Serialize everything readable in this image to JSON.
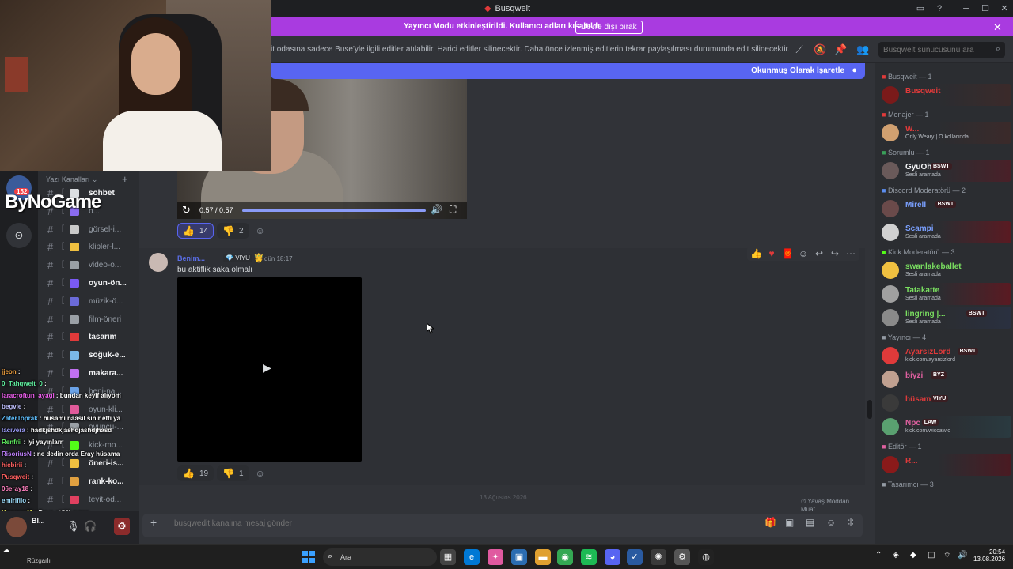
{
  "window": {
    "title": "Busqweit",
    "title_icon": "busqweit-logo-icon"
  },
  "banner": {
    "text": "Yayıncı Modu etkinleştirildi. Kullanıcı adları kısaltıldı.",
    "button": "Devre dışı bırak",
    "color": "#a93be0"
  },
  "channel_header": {
    "topic": "it odasına sadece Buse'yle ilgili editler atılabilir. Harici editler silinecektir. Daha önce izlenmiş editlerin tekrar paylaşılması durumunda edit silinecektir. Editör rolü...",
    "search_placeholder": "Busqweit sunucusunu ara"
  },
  "mark_read": {
    "label": "Okunmuş Olarak İşaretle",
    "color": "#5865f2"
  },
  "sidebar": {
    "category": "Yazı Kanalları",
    "badge": "152",
    "brand_overlay": "ByNoGame",
    "channels": [
      {
        "name": "sohbet",
        "unread": true,
        "color": "#dbdee1"
      },
      {
        "name": "b...",
        "unread": false,
        "color": "#8a6cf0"
      },
      {
        "name": "görsel-i...",
        "unread": false,
        "color": "#c9c9c9"
      },
      {
        "name": "klipler-l...",
        "unread": false,
        "color": "#f0c040"
      },
      {
        "name": "video-ö...",
        "unread": false,
        "color": "#9aa0a6"
      },
      {
        "name": "oyun-ön...",
        "unread": true,
        "color": "#7a5af5"
      },
      {
        "name": "müzik-ö...",
        "unread": false,
        "color": "#6b6bd9"
      },
      {
        "name": "film-öneri",
        "unread": false,
        "color": "#9aa0a6"
      },
      {
        "name": "tasarım",
        "unread": true,
        "color": "#e03a3a"
      },
      {
        "name": "soğuk-e...",
        "unread": true,
        "color": "#7ab8e8"
      },
      {
        "name": "makara...",
        "unread": true,
        "color": "#c070f0"
      },
      {
        "name": "beni-na...",
        "unread": false,
        "color": "#6ba3e8"
      },
      {
        "name": "oyun-kli...",
        "unread": false,
        "color": "#e05a9a"
      },
      {
        "name": "oyuncu-...",
        "unread": false,
        "color": "#9aa0a6"
      },
      {
        "name": "kick-mo...",
        "unread": false,
        "color": "#53fc18"
      },
      {
        "name": "öneri-is...",
        "unread": true,
        "color": "#f0c040"
      },
      {
        "name": "rank-ko...",
        "unread": true,
        "color": "#e0a040"
      },
      {
        "name": "teyit-od...",
        "unread": false,
        "color": "#e04060"
      }
    ]
  },
  "chat_overlay": [
    {
      "user": "jjeon",
      "msg": ":",
      "color": "#f0a040"
    },
    {
      "user": "0_Tahqweit_0",
      "msg": ":",
      "color": "#60f0a0"
    },
    {
      "user": "laracroftun_ayagi",
      "msg": ": bundan keyif alıyom",
      "color": "#f060f0"
    },
    {
      "user": "begvie",
      "msg": ":",
      "color": "#c0c0ff"
    },
    {
      "user": "ZaferToprak",
      "msg": ": hüsamı naasıl sinir etti ya",
      "color": "#60c0ff"
    },
    {
      "user": "lacivera",
      "msg": ": hadkjshdkjashdjashdjhasd",
      "color": "#a0a0ff"
    },
    {
      "user": "Renfrii",
      "msg": ": iyi yayınlarr",
      "color": "#60f060"
    },
    {
      "user": "RisoriusN",
      "msg": ": ne dedin orda Eray hüsama",
      "color": "#c080ff"
    },
    {
      "user": "hicbirii",
      "msg": ":",
      "color": "#ff6060"
    },
    {
      "user": "Pusqweit",
      "msg": ":",
      "color": "#ff6060"
    },
    {
      "user": "06eray18",
      "msg": ":",
      "color": "#ff80c0"
    },
    {
      "user": "emirifilo",
      "msg": ":",
      "color": "#a0e0ff"
    },
    {
      "user": "Kruuser46",
      "msg": ": Dava ettiği evren",
      "color": "#f0f060"
    },
    {
      "user": "Whiqqweit",
      "msg": ":",
      "color": "#c0c0c0"
    },
    {
      "user": "ZaferToprak",
      "msg": ":",
      "color": "#60c0ff"
    },
    {
      "user": "lasiyom",
      "msg": ": ASJDHKJASDHA",
      "color": "#a0ffa0"
    }
  ],
  "user_panel": {
    "name": "Bl..."
  },
  "message1": {
    "video_time": "0:57 / 0:57",
    "reactions": [
      {
        "emoji": "👍",
        "count": "14",
        "active": true
      },
      {
        "emoji": "👎",
        "count": "2",
        "active": false
      }
    ]
  },
  "message2": {
    "author": "Benim...",
    "tag": "VIYU",
    "timestamp": "dün 18:17",
    "text": "bu aktiflik saka olmalı",
    "reactions": [
      {
        "emoji": "👍",
        "count": "19",
        "active": false
      },
      {
        "emoji": "👎",
        "count": "1",
        "active": false
      }
    ]
  },
  "divider": {
    "date": "13 Ağustos 2026",
    "slowmode": "Yavaş Moddan Muaf"
  },
  "composer": {
    "placeholder": "busqwedit kanalına mesaj gönder"
  },
  "members": {
    "roles": [
      {
        "header": "Busqweit — 1",
        "color": "#e03a3a",
        "members": [
          {
            "name": "Busqweit",
            "color": "#e03a3a",
            "sub": "",
            "badge": "",
            "ava": "#7a1a1a",
            "bg": "#3b2a2a"
          }
        ]
      },
      {
        "header": "Menajer — 1",
        "color": "#e03a3a",
        "members": [
          {
            "name": "W...",
            "color": "#e03a3a",
            "sub": "Only Weary | O kollarında...",
            "badge": "",
            "ava": "#d0a070",
            "bg": "#3b2a2a"
          }
        ]
      },
      {
        "header": "Sorumlu — 1",
        "color": "#3aa05a",
        "members": [
          {
            "name": "GyuOh",
            "color": "#f2f3f5",
            "sub": "Sesli aramada",
            "badge": "BSWT",
            "ava": "#6a5a5a",
            "bg": "#4a2028"
          }
        ]
      },
      {
        "header": "Discord Moderatörü — 2",
        "color": "#5b8def",
        "members": [
          {
            "name": "Mirell",
            "color": "#7aa0ff",
            "sub": "",
            "badge": "BSWT",
            "ava": "#6a4a4a",
            "bg": "#2b2d31"
          },
          {
            "name": "Scampi",
            "color": "#7aa0ff",
            "sub": "Sesli aramada",
            "badge": "",
            "ava": "#d0d0d0",
            "bg": "#5a1a22"
          }
        ]
      },
      {
        "header": "Kick Moderatörü — 3",
        "color": "#53fc18",
        "members": [
          {
            "name": "swanlakeballet",
            "color": "#7ae060",
            "sub": "Sesli aramada",
            "badge": "",
            "ava": "#f0c040",
            "bg": "#2b2d31"
          },
          {
            "name": "Tatakatte",
            "color": "#7ae060",
            "sub": "Sesli aramada",
            "badge": "",
            "ava": "#a0a0a0",
            "bg": "#5a1a22"
          },
          {
            "name": "lingring |...",
            "color": "#7ae060",
            "sub": "Sesli aramada",
            "badge": "BSWT",
            "ava": "#8a8a8a",
            "bg": "#2a3040"
          }
        ]
      },
      {
        "header": "Yayıncı — 4",
        "color": "#949ba4",
        "members": [
          {
            "name": "AyarsızLord",
            "color": "#e03a3a",
            "sub": "kick.com/ayarsizlord",
            "badge": "BSWT",
            "ava": "#e03a3a",
            "bg": "#2b2d31"
          },
          {
            "name": "biyzi",
            "color": "#e060a0",
            "sub": "",
            "badge": "BYZ",
            "ava": "#c0a090",
            "bg": "#2b2d31"
          },
          {
            "name": "hüsam",
            "color": "#e03a3a",
            "sub": "",
            "badge": "VIYU",
            "ava": "#3a3a3a",
            "bg": "#2b2d31"
          },
          {
            "name": "Npc",
            "color": "#e060a0",
            "sub": "kick.com/wiccawic",
            "badge": "LAW",
            "ava": "#5aa070",
            "bg": "#2a3a40"
          }
        ]
      },
      {
        "header": "Editör — 1",
        "color": "#e060a0",
        "members": [
          {
            "name": "R...",
            "color": "#e03a3a",
            "sub": "",
            "badge": "",
            "ava": "#8a1a1a",
            "bg": "#4a1a22"
          }
        ]
      },
      {
        "header": "Tasarımcı — 3",
        "color": "#949ba4",
        "members": []
      }
    ]
  },
  "taskbar": {
    "weather": "Rüzgarlı",
    "search_label": "Ara",
    "time": "20:54",
    "date": "13.08.2026"
  }
}
